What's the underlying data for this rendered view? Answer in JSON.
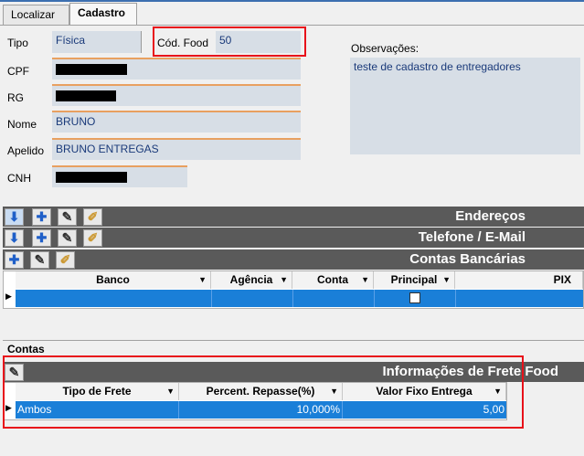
{
  "tabs": [
    "Localizar",
    "Cadastro"
  ],
  "form": {
    "tipo_label": "Tipo",
    "tipo_value": "Física",
    "cod_food_label": "Cód. Food",
    "cod_food_value": "50",
    "cpf_label": "CPF",
    "rg_label": "RG",
    "nome_label": "Nome",
    "nome_value": "BRUNO",
    "apelido_label": "Apelido",
    "apelido_value": "BRUNO ENTREGAS",
    "cnh_label": "CNH",
    "obs_label": "Observações:",
    "obs_value": "teste de cadastro de entregadores"
  },
  "sections": {
    "enderecos": "Endereços",
    "telefone": "Telefone / E-Mail",
    "contas": "Contas Bancárias"
  },
  "bank_grid": {
    "columns": [
      "Banco",
      "Agência",
      "Conta",
      "Principal",
      "PIX"
    ]
  },
  "contas_tab": "Contas",
  "frete": {
    "title": "Informações de Frete Food",
    "columns": [
      "Tipo de Frete",
      "Percent. Repasse(%)",
      "Valor Fixo Entrega"
    ],
    "row": {
      "tipo": "Ambos",
      "percent": "10,000%",
      "valor": "5,00"
    }
  },
  "colors": {
    "accent": "#1a7fd8",
    "bar": "#5a5a5a",
    "highlight": "#e8111a"
  }
}
